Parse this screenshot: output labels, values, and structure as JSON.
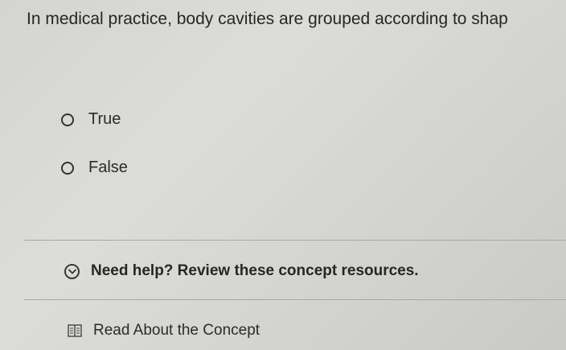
{
  "question": {
    "text": "In medical practice, body cavities are grouped according to shap"
  },
  "options": [
    {
      "label": "True"
    },
    {
      "label": "False"
    }
  ],
  "help": {
    "label": "Need help? Review these concept resources."
  },
  "resources": {
    "read_label": "Read About the Concept"
  },
  "icons": {
    "help_toggle": "chevron-down-circle-icon",
    "read": "book-icon"
  }
}
